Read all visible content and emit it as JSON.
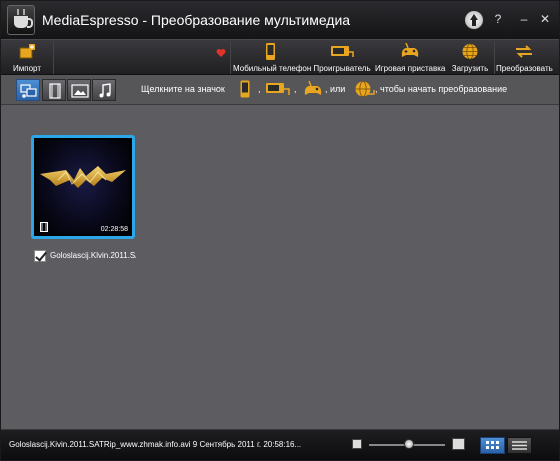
{
  "window": {
    "title": "MediaEspresso - Преобразование мультимедиа",
    "controls": {
      "help": "?",
      "minimize": "–",
      "close": "✕"
    }
  },
  "toolbar": {
    "import_label": "Импорт",
    "items": [
      {
        "label": "Мобильный телефон",
        "icon": "mobile-phone-icon"
      },
      {
        "label": "Проигрыватель",
        "icon": "player-icon"
      },
      {
        "label": "Игровая приставка",
        "icon": "game-console-icon"
      },
      {
        "label": "Загрузить",
        "icon": "globe-icon"
      },
      {
        "label": "Преобразовать",
        "icon": "convert-arrows-icon"
      }
    ]
  },
  "filterbar": {
    "filters": [
      {
        "name": "all-media",
        "active": true
      },
      {
        "name": "video",
        "active": false
      },
      {
        "name": "photo",
        "active": false
      },
      {
        "name": "music",
        "active": false
      }
    ],
    "hint_start": "Щелкните на значок",
    "hint_or": ", или",
    "hint_end": ", чтобы начать преобразование"
  },
  "media": {
    "items": [
      {
        "filename": "Goloslascij.Klvin.2011.SAT",
        "duration": "02:28:58",
        "checked": true
      }
    ]
  },
  "statusbar": {
    "info": "Goloslascij.Kivin.2011.SATRip_www.zhmak.info.avi  9 Сентябрь 2011 г. 20:58:16...",
    "zoom_level": 0.52
  },
  "colors": {
    "accent_blue": "#29a7e8",
    "icon_gold": "#e8a520",
    "background": "#5d5d61"
  }
}
